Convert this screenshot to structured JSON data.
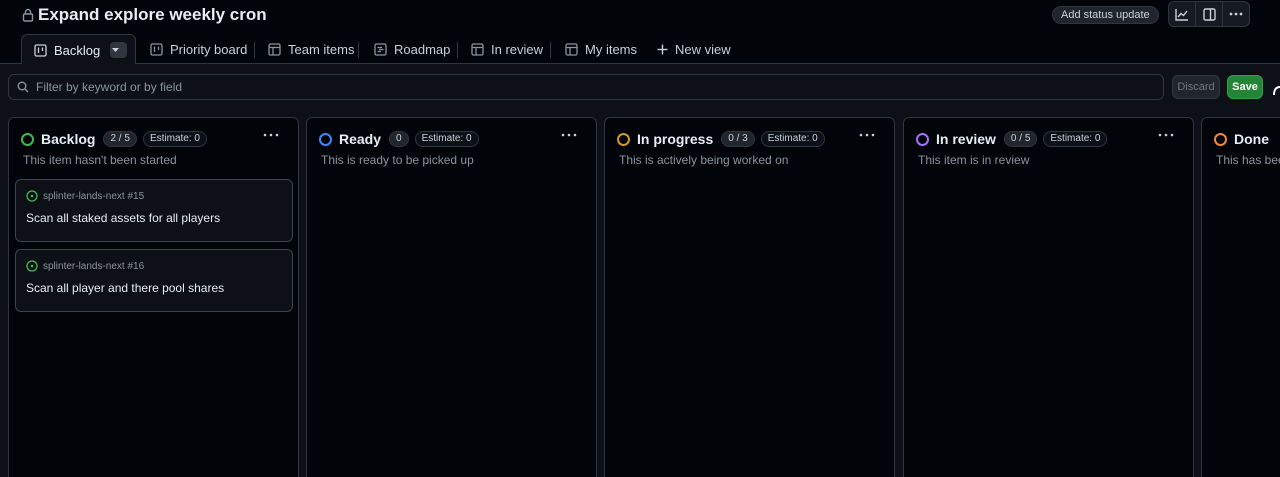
{
  "header": {
    "title": "Expand explore weekly cron",
    "status_button": "Add status update"
  },
  "toolbar": {
    "icons": [
      "insights-icon",
      "side-panel-icon",
      "more-icon"
    ]
  },
  "tabs": [
    {
      "label": "Backlog",
      "icon": "board-icon",
      "active": true
    },
    {
      "label": "Priority board",
      "icon": "board-icon"
    },
    {
      "label": "Team items",
      "icon": "table-icon"
    },
    {
      "label": "Roadmap",
      "icon": "roadmap-icon"
    },
    {
      "label": "In review",
      "icon": "table-icon"
    },
    {
      "label": "My items",
      "icon": "table-icon"
    }
  ],
  "new_view": "New view",
  "filter": {
    "placeholder": "Filter by keyword or by field",
    "discard": "Discard",
    "save": "Save"
  },
  "colors": {
    "backlog": "#3fb950",
    "ready": "#388bfd",
    "in_progress": "#d29922",
    "in_review": "#a371f7",
    "done": "#f0883e"
  },
  "columns": [
    {
      "name": "Backlog",
      "count": "2 / 5",
      "estimate": "Estimate: 0",
      "description": "This item hasn't been started",
      "cards": [
        {
          "meta": "splinter-lands-next #15",
          "title": "Scan all staked assets for all players"
        },
        {
          "meta": "splinter-lands-next #16",
          "title": "Scan all player and there pool shares"
        }
      ]
    },
    {
      "name": "Ready",
      "count": "0",
      "estimate": "Estimate: 0",
      "description": "This is ready to be picked up"
    },
    {
      "name": "In progress",
      "count": "0 / 3",
      "estimate": "Estimate: 0",
      "description": "This is actively being worked on"
    },
    {
      "name": "In review",
      "count": "0 / 5",
      "estimate": "Estimate: 0",
      "description": "This item is in review"
    },
    {
      "name": "Done",
      "description": "This has been"
    }
  ]
}
